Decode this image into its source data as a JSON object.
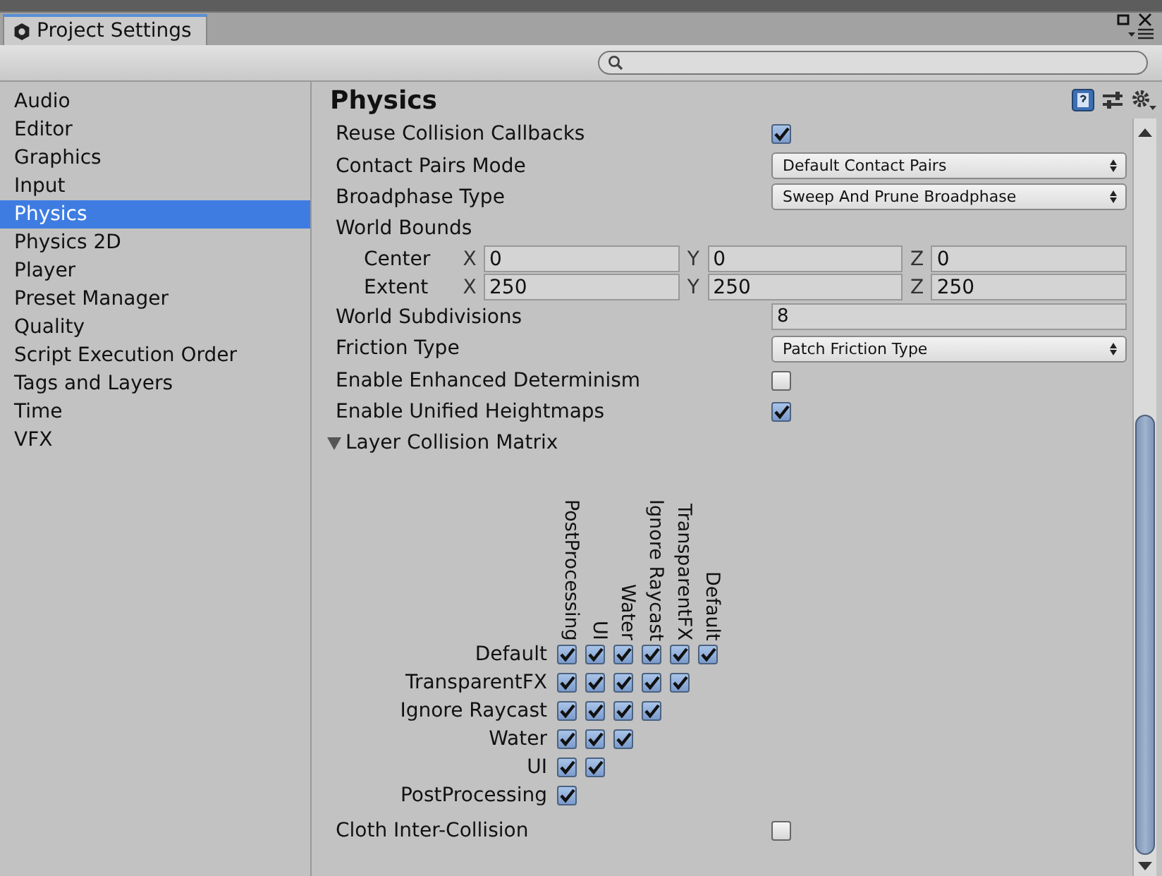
{
  "window": {
    "tab": "Project Settings"
  },
  "sidebar": {
    "items": [
      {
        "label": "Audio",
        "selected": false
      },
      {
        "label": "Editor",
        "selected": false
      },
      {
        "label": "Graphics",
        "selected": false
      },
      {
        "label": "Input",
        "selected": false
      },
      {
        "label": "Physics",
        "selected": true
      },
      {
        "label": "Physics 2D",
        "selected": false
      },
      {
        "label": "Player",
        "selected": false
      },
      {
        "label": "Preset Manager",
        "selected": false
      },
      {
        "label": "Quality",
        "selected": false
      },
      {
        "label": "Script Execution Order",
        "selected": false
      },
      {
        "label": "Tags and Layers",
        "selected": false
      },
      {
        "label": "Time",
        "selected": false
      },
      {
        "label": "VFX",
        "selected": false
      }
    ]
  },
  "panel": {
    "title": "Physics",
    "properties": [
      {
        "kind": "checkbox",
        "label": "Reuse Collision Callbacks",
        "checked": true
      },
      {
        "kind": "dropdown",
        "label": "Contact Pairs Mode",
        "value": "Default Contact Pairs"
      },
      {
        "kind": "dropdown",
        "label": "Broadphase Type",
        "value": "Sweep And Prune Broadphase"
      },
      {
        "kind": "heading",
        "label": "World Bounds"
      },
      {
        "kind": "vector",
        "label": "Center",
        "axes": [
          {
            "axis": "X",
            "value": "0"
          },
          {
            "axis": "Y",
            "value": "0"
          },
          {
            "axis": "Z",
            "value": "0"
          }
        ]
      },
      {
        "kind": "vector",
        "label": "Extent",
        "axes": [
          {
            "axis": "X",
            "value": "250"
          },
          {
            "axis": "Y",
            "value": "250"
          },
          {
            "axis": "Z",
            "value": "250"
          }
        ]
      },
      {
        "kind": "number",
        "label": "World Subdivisions",
        "value": "8"
      },
      {
        "kind": "dropdown",
        "label": "Friction Type",
        "value": "Patch Friction Type"
      },
      {
        "kind": "checkbox",
        "label": "Enable Enhanced Determinism",
        "checked": false
      },
      {
        "kind": "checkbox",
        "label": "Enable Unified Heightmaps",
        "checked": true
      }
    ],
    "matrix": {
      "label": "Layer Collision Matrix",
      "expanded": true,
      "columns": [
        "PostProcessing",
        "UI",
        "Water",
        "Ignore Raycast",
        "TransparentFX",
        "Default"
      ],
      "rows": [
        {
          "label": "Default",
          "cells": [
            {
              "checked": true
            },
            {
              "checked": true
            },
            {
              "checked": true
            },
            {
              "checked": true
            },
            {
              "checked": true
            },
            {
              "checked": true
            }
          ]
        },
        {
          "label": "TransparentFX",
          "cells": [
            {
              "checked": true
            },
            {
              "checked": true
            },
            {
              "checked": true
            },
            {
              "checked": true
            },
            {
              "checked": true
            }
          ]
        },
        {
          "label": "Ignore Raycast",
          "cells": [
            {
              "checked": true
            },
            {
              "checked": true
            },
            {
              "checked": true
            },
            {
              "checked": true
            }
          ]
        },
        {
          "label": "Water",
          "cells": [
            {
              "checked": true
            },
            {
              "checked": true
            },
            {
              "checked": true
            }
          ]
        },
        {
          "label": "UI",
          "cells": [
            {
              "checked": true
            },
            {
              "checked": true
            }
          ]
        },
        {
          "label": "PostProcessing",
          "cells": [
            {
              "checked": true
            }
          ]
        }
      ]
    },
    "after": [
      {
        "kind": "checkbox",
        "label": "Cloth Inter-Collision",
        "checked": false
      }
    ]
  }
}
